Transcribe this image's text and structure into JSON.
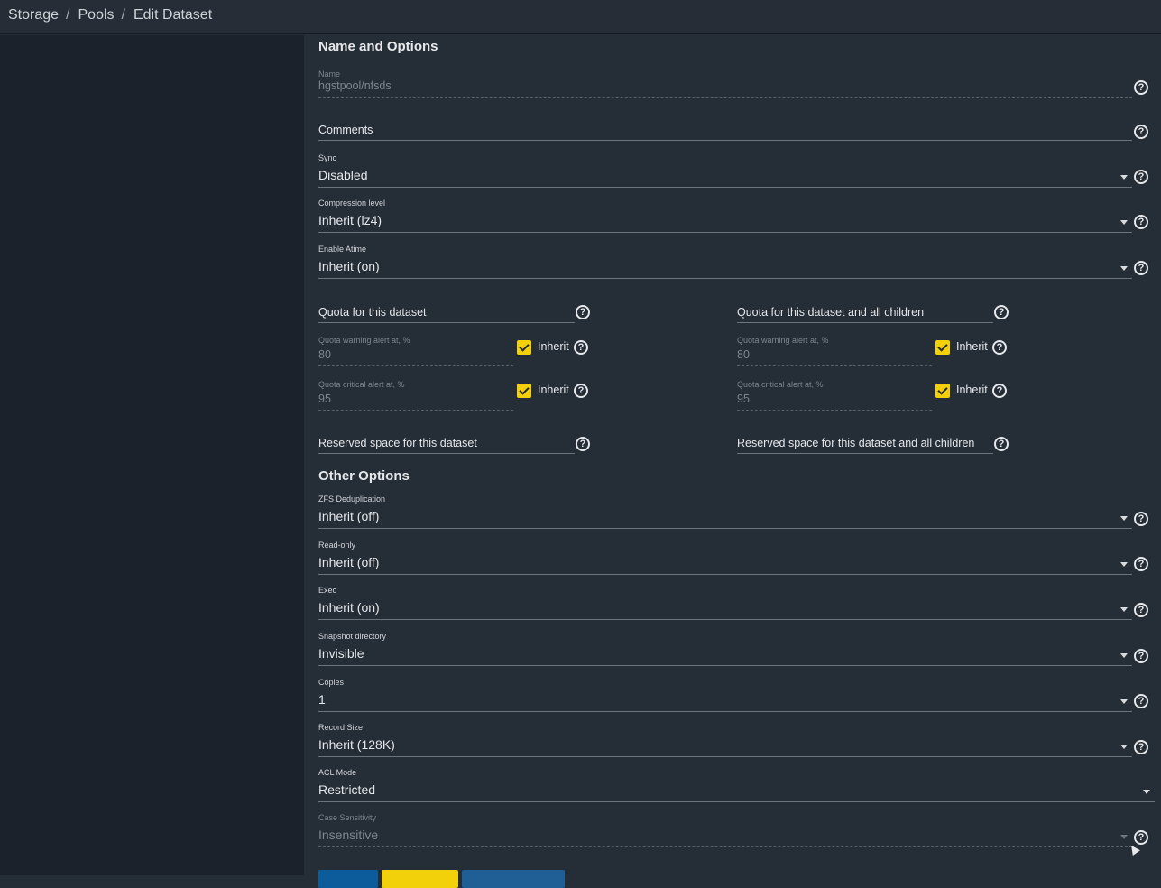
{
  "breadcrumb": {
    "items": [
      "Storage",
      "Pools",
      "Edit Dataset"
    ]
  },
  "sections": {
    "name_options": "Name and Options",
    "other_options": "Other Options"
  },
  "name": {
    "label": "Name",
    "value": "hgstpool/nfsds"
  },
  "comments": {
    "placeholder": "Comments"
  },
  "sync": {
    "label": "Sync",
    "value": "Disabled"
  },
  "compression": {
    "label": "Compression level",
    "value": "Inherit (lz4)"
  },
  "atime": {
    "label": "Enable Atime",
    "value": "Inherit (on)"
  },
  "quota": {
    "dataset": "Quota for this dataset",
    "children": "Quota for this dataset and all children",
    "warning_label": "Quota warning alert at, %",
    "warning_value": "80",
    "critical_label": "Quota critical alert at, %",
    "critical_value": "95",
    "inherit_label": "Inherit",
    "inherit_checked": true
  },
  "reserved": {
    "dataset": "Reserved space for this dataset",
    "children": "Reserved space for this dataset and all children"
  },
  "dedup": {
    "label": "ZFS Deduplication",
    "value": "Inherit (off)"
  },
  "readonly": {
    "label": "Read-only",
    "value": "Inherit (off)"
  },
  "exec": {
    "label": "Exec",
    "value": "Inherit (on)"
  },
  "snapdir": {
    "label": "Snapshot directory",
    "value": "Invisible"
  },
  "copies": {
    "label": "Copies",
    "value": "1"
  },
  "recordsize": {
    "label": "Record Size",
    "value": "Inherit (128K)"
  },
  "aclmode": {
    "label": "ACL Mode",
    "value": "Restricted"
  },
  "casesensitivity": {
    "label": "Case Sensitivity",
    "value": "Insensitive"
  },
  "help_glyph": "?",
  "colors": {
    "accent_yellow": "#f2d00a",
    "primary_blue": "#0c5c9b",
    "secondary_blue": "#1f5f96"
  }
}
